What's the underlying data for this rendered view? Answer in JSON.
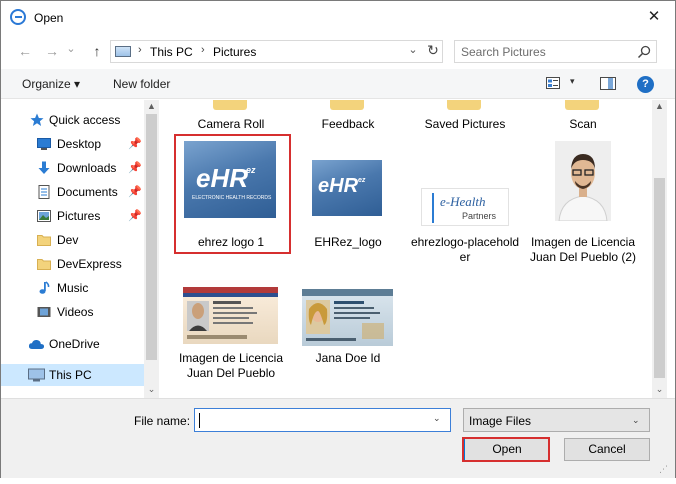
{
  "window": {
    "title": "Open",
    "close_glyph": "✕"
  },
  "nav": {
    "back_glyph": "←",
    "forward_glyph": "→",
    "history_glyph": "⌄",
    "up_glyph": "↑",
    "address": [
      "This PC",
      "Pictures"
    ],
    "address_sep": "›",
    "address_dd_glyph": "⌄",
    "refresh_glyph": "↻",
    "search_placeholder": "Search Pictures"
  },
  "toolbar": {
    "organize": "Organize ▾",
    "new_folder": "New folder",
    "view_dd_glyph": "▾",
    "help_glyph": "?"
  },
  "sidebar": {
    "pin_glyph": "📌",
    "items": [
      {
        "label": "Quick access",
        "icon": "star-icon",
        "pinned": false
      },
      {
        "label": "Desktop",
        "icon": "desktop-icon",
        "pinned": true
      },
      {
        "label": "Downloads",
        "icon": "downloads-icon",
        "pinned": true
      },
      {
        "label": "Documents",
        "icon": "documents-icon",
        "pinned": true
      },
      {
        "label": "Pictures",
        "icon": "pictures-icon",
        "pinned": true
      },
      {
        "label": "Dev",
        "icon": "folder-icon",
        "pinned": false
      },
      {
        "label": "DevExpress",
        "icon": "folder-icon",
        "pinned": false
      },
      {
        "label": "Music",
        "icon": "music-icon",
        "pinned": false
      },
      {
        "label": "Videos",
        "icon": "videos-icon",
        "pinned": false
      },
      {
        "label": "OneDrive",
        "icon": "cloud-icon",
        "pinned": false
      },
      {
        "label": "This PC",
        "icon": "pc-icon",
        "pinned": false,
        "selected": true
      }
    ],
    "scroll_up": "▲",
    "scroll_down": "⌄"
  },
  "folders": [
    "Camera Roll",
    "Feedback",
    "Saved Pictures",
    "Scan"
  ],
  "files": [
    {
      "name": "ehrez logo 1",
      "selected": true
    },
    {
      "name": "EHRez_logo",
      "selected": false
    },
    {
      "name": "ehrezlogo-placeholder",
      "selected": false
    },
    {
      "name": "Imagen de Licencia Juan Del Pueblo (2)",
      "selected": false
    },
    {
      "name": "Imagen de Licencia Juan Del Pueblo",
      "selected": false
    },
    {
      "name": "Jana Doe Id",
      "selected": false
    }
  ],
  "logo_text": {
    "ehr": "eHR",
    "ez": "ez",
    "tag": "ELECTRONIC HEALTH RECORDS",
    "e_health": "e-Health",
    "partners": "Partners"
  },
  "content_scroll": {
    "up": "▲",
    "down": "⌄"
  },
  "footer": {
    "file_name_label": "File name:",
    "file_name_value": "",
    "file_name_dd": "⌄",
    "file_type": "Image Files",
    "file_type_dd": "⌄",
    "open_label": "Open",
    "cancel_label": "Cancel",
    "grip": "⋰"
  },
  "colors": {
    "accent": "#0078d7",
    "highlight_box": "#d62f2f",
    "selection": "#cce8ff"
  }
}
